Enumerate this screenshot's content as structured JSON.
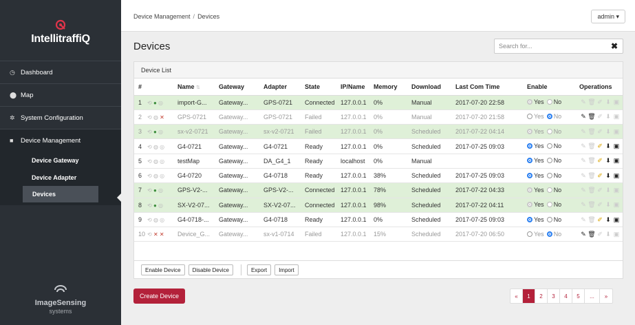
{
  "brand": {
    "name": "IntellitraffiQ",
    "vendor": "ImageSensing",
    "vendor_sub": "systems"
  },
  "nav": {
    "dashboard": "Dashboard",
    "map": "Map",
    "system_configuration": "System Configuration",
    "device_management": "Device Management",
    "device_gateway": "Device Gateway",
    "device_adapter": "Device Adapter",
    "devices": "Devices"
  },
  "breadcrumb": {
    "parent": "Device Management",
    "separator": "/",
    "current": "Devices"
  },
  "user_menu": {
    "label": "admin ▾"
  },
  "page": {
    "title": "Devices"
  },
  "search": {
    "placeholder": "Search for...",
    "value": "",
    "clear": "✖"
  },
  "panel": {
    "title": "Device List"
  },
  "table": {
    "headers": [
      "#",
      "Name",
      "Gateway",
      "Adapter",
      "State",
      "IP/Name",
      "Memory",
      "Download",
      "Last Com Time",
      "Enable",
      "Operations"
    ],
    "sort_indicator": "⇅",
    "enable_options": [
      "Yes",
      "No"
    ],
    "rows": [
      [
        "1",
        "import-G...",
        "Gateway...",
        "GPS-0721",
        "Connected",
        "127.0.0.1",
        "0%",
        "Manual",
        "2017-07-20 22:58",
        "",
        ""
      ],
      [
        "2",
        "GPS-0721",
        "Gateway...",
        "GPS-0721",
        "Failed",
        "127.0.0.1",
        "0%",
        "Manual",
        "2017-07-20 21:58",
        "",
        ""
      ],
      [
        "3",
        "sx-v2-0721",
        "Gateway...",
        "sx-v2-0721",
        "Failed",
        "127.0.0.1",
        "0%",
        "Scheduled",
        "2017-07-22 04:14",
        "",
        ""
      ],
      [
        "4",
        "G4-0721",
        "Gateway...",
        "G4-0721",
        "Ready",
        "127.0.0.1",
        "0%",
        "Scheduled",
        "2017-07-25 09:03",
        "",
        ""
      ],
      [
        "5",
        "testMap",
        "Gateway...",
        "DA_G4_1",
        "Ready",
        "localhost",
        "0%",
        "Manual",
        "",
        "",
        ""
      ],
      [
        "6",
        "G4-0720",
        "Gateway...",
        "G4-0718",
        "Ready",
        "127.0.0.1",
        "38%",
        "Scheduled",
        "2017-07-25 09:03",
        "",
        ""
      ],
      [
        "7",
        "GPS-V2-...",
        "Gateway...",
        "GPS-V2-...",
        "Connected",
        "127.0.0.1",
        "78%",
        "Scheduled",
        "2017-07-22 04:33",
        "",
        ""
      ],
      [
        "8",
        "SX-V2-07...",
        "Gateway...",
        "SX-V2-07...",
        "Connected",
        "127.0.0.1",
        "98%",
        "Scheduled",
        "2017-07-22 04:11",
        "",
        ""
      ],
      [
        "9",
        "G4-0718-...",
        "Gateway...",
        "G4-0718",
        "Ready",
        "127.0.0.1",
        "0%",
        "Scheduled",
        "2017-07-25 09:03",
        "",
        ""
      ],
      [
        "10",
        "Device_G...",
        "Gateway...",
        "sx-v1-0714",
        "Failed",
        "127.0.0.1",
        "15%",
        "Scheduled",
        "2017-07-20 06:50",
        "",
        ""
      ]
    ],
    "row_green": [
      true,
      false,
      true,
      false,
      false,
      false,
      true,
      true,
      false,
      false
    ],
    "row_dim": [
      false,
      true,
      true,
      false,
      false,
      false,
      false,
      false,
      false,
      true
    ],
    "enabled": [
      "Yes",
      "No",
      "Yes",
      "Yes",
      "Yes",
      "Yes",
      "Yes",
      "Yes",
      "Yes",
      "No"
    ],
    "enable_gray": [
      true,
      false,
      true,
      false,
      false,
      false,
      true,
      true,
      false,
      false
    ],
    "ops_active": [
      [
        false,
        false,
        false,
        false,
        false
      ],
      [
        true,
        true,
        false,
        false,
        false
      ],
      [
        false,
        false,
        false,
        false,
        false
      ],
      [
        false,
        false,
        true,
        true,
        true
      ],
      [
        false,
        false,
        true,
        true,
        true
      ],
      [
        false,
        false,
        true,
        true,
        true
      ],
      [
        false,
        false,
        false,
        false,
        false
      ],
      [
        false,
        false,
        false,
        false,
        false
      ],
      [
        false,
        false,
        true,
        true,
        true
      ],
      [
        true,
        true,
        false,
        false,
        false
      ]
    ]
  },
  "footer_buttons": {
    "enable": "Enable Device",
    "disable": "Disable Device",
    "export": "Export",
    "import": "Import"
  },
  "create_button": "Create Device",
  "pagination": {
    "prev": "«",
    "pages": [
      "1",
      "2",
      "3",
      "4",
      "5"
    ],
    "ellipsis": "...",
    "next": "»",
    "current": "1"
  },
  "colors": {
    "accent": "#b3213a",
    "connected_row": "#dff0d8",
    "sidebar": "#2b3036",
    "radio_on": "#2a7ff0"
  }
}
